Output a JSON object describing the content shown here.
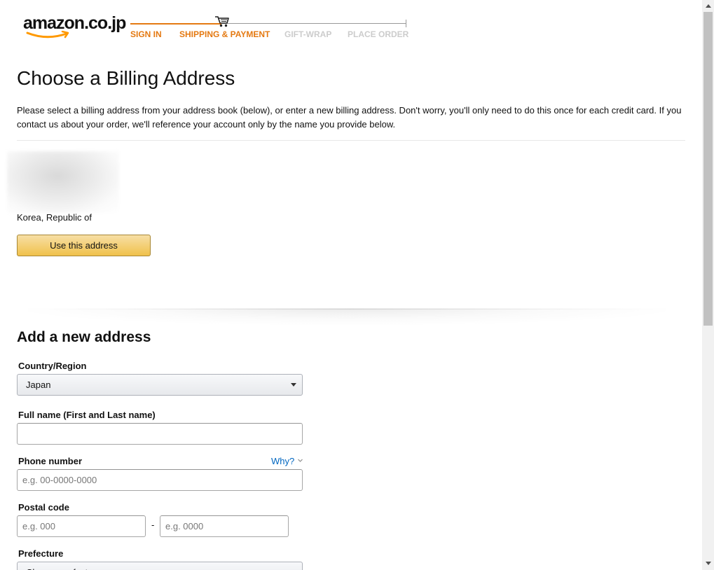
{
  "header": {
    "logo_text": "amazon.co.jp",
    "steps": [
      {
        "label": "SIGN IN",
        "state": "done"
      },
      {
        "label": "SHIPPING & PAYMENT",
        "state": "current"
      },
      {
        "label": "GIFT-WRAP",
        "state": "todo"
      },
      {
        "label": "PLACE ORDER",
        "state": "todo"
      }
    ],
    "accent_color": "#e47911"
  },
  "main": {
    "title": "Choose a Billing Address",
    "intro": "Please select a billing address from your address book (below), or enter a new billing address. Don't worry, you'll only need to do this once for each credit card. If you contact us about your order, we'll reference your account only by the name you provide below.",
    "saved_address": {
      "country": "Korea, Republic of",
      "use_button": "Use this address"
    }
  },
  "new_address": {
    "heading": "Add a new address",
    "country_label": "Country/Region",
    "country_value": "Japan",
    "fullname_label": "Full name (First and Last name)",
    "fullname_value": "",
    "phone_label": "Phone number",
    "phone_placeholder": "e.g. 00-0000-0000",
    "why_link": "Why?",
    "postal_label": "Postal code",
    "postal_placeholder_1": "e.g. 000",
    "postal_separator": "-",
    "postal_placeholder_2": "e.g. 0000",
    "prefecture_label": "Prefecture",
    "prefecture_value": "Choose prefecture"
  }
}
